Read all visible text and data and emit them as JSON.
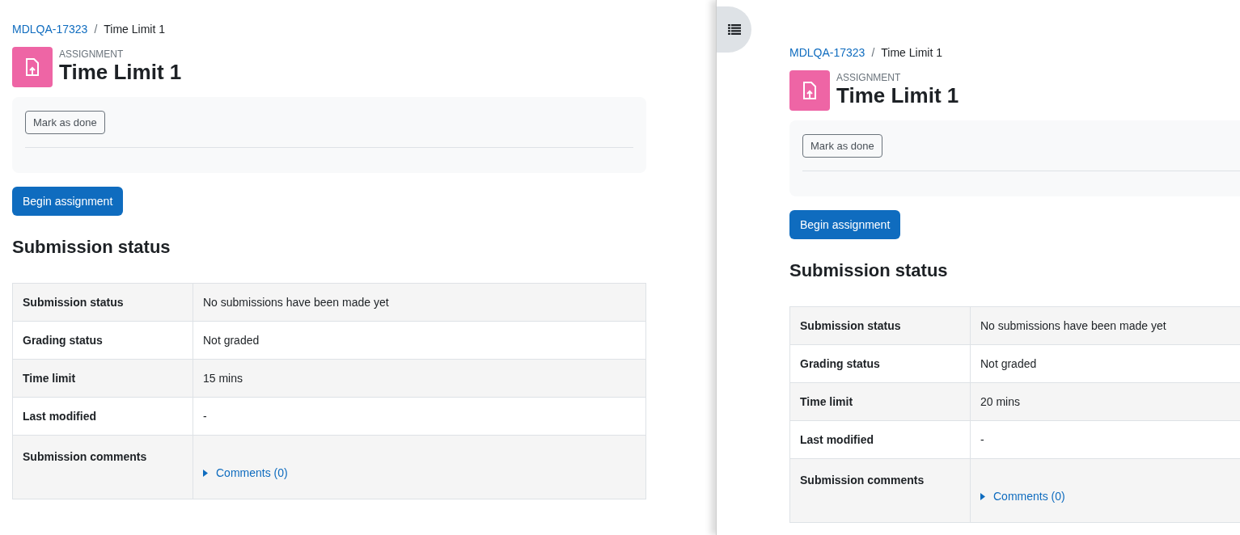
{
  "panes": [
    {
      "breadcrumb": {
        "link": "MDLQA-17323",
        "separator": "/",
        "current": "Time Limit 1"
      },
      "activity_type": "ASSIGNMENT",
      "title": "Time Limit 1",
      "mark_button": "Mark as done",
      "primary_button": "Begin assignment",
      "section_heading": "Submission status",
      "rows": [
        {
          "label": "Submission status",
          "value": "No submissions have been made yet",
          "kind": "text"
        },
        {
          "label": "Grading status",
          "value": "Not graded",
          "kind": "text"
        },
        {
          "label": "Time limit",
          "value": "15 mins",
          "kind": "text"
        },
        {
          "label": "Last modified",
          "value": "-",
          "kind": "text"
        },
        {
          "label": "Submission comments",
          "value": "Comments (0)",
          "kind": "comments"
        }
      ]
    },
    {
      "breadcrumb": {
        "link": "MDLQA-17323",
        "separator": "/",
        "current": "Time Limit 1"
      },
      "activity_type": "ASSIGNMENT",
      "title": "Time Limit 1",
      "mark_button": "Mark as done",
      "primary_button": "Begin assignment",
      "section_heading": "Submission status",
      "rows": [
        {
          "label": "Submission status",
          "value": "No submissions have been made yet",
          "kind": "text"
        },
        {
          "label": "Grading status",
          "value": "Not graded",
          "kind": "text"
        },
        {
          "label": "Time limit",
          "value": "20 mins",
          "kind": "text"
        },
        {
          "label": "Last modified",
          "value": "-",
          "kind": "text"
        },
        {
          "label": "Submission comments",
          "value": "Comments (0)",
          "kind": "comments"
        }
      ]
    }
  ]
}
